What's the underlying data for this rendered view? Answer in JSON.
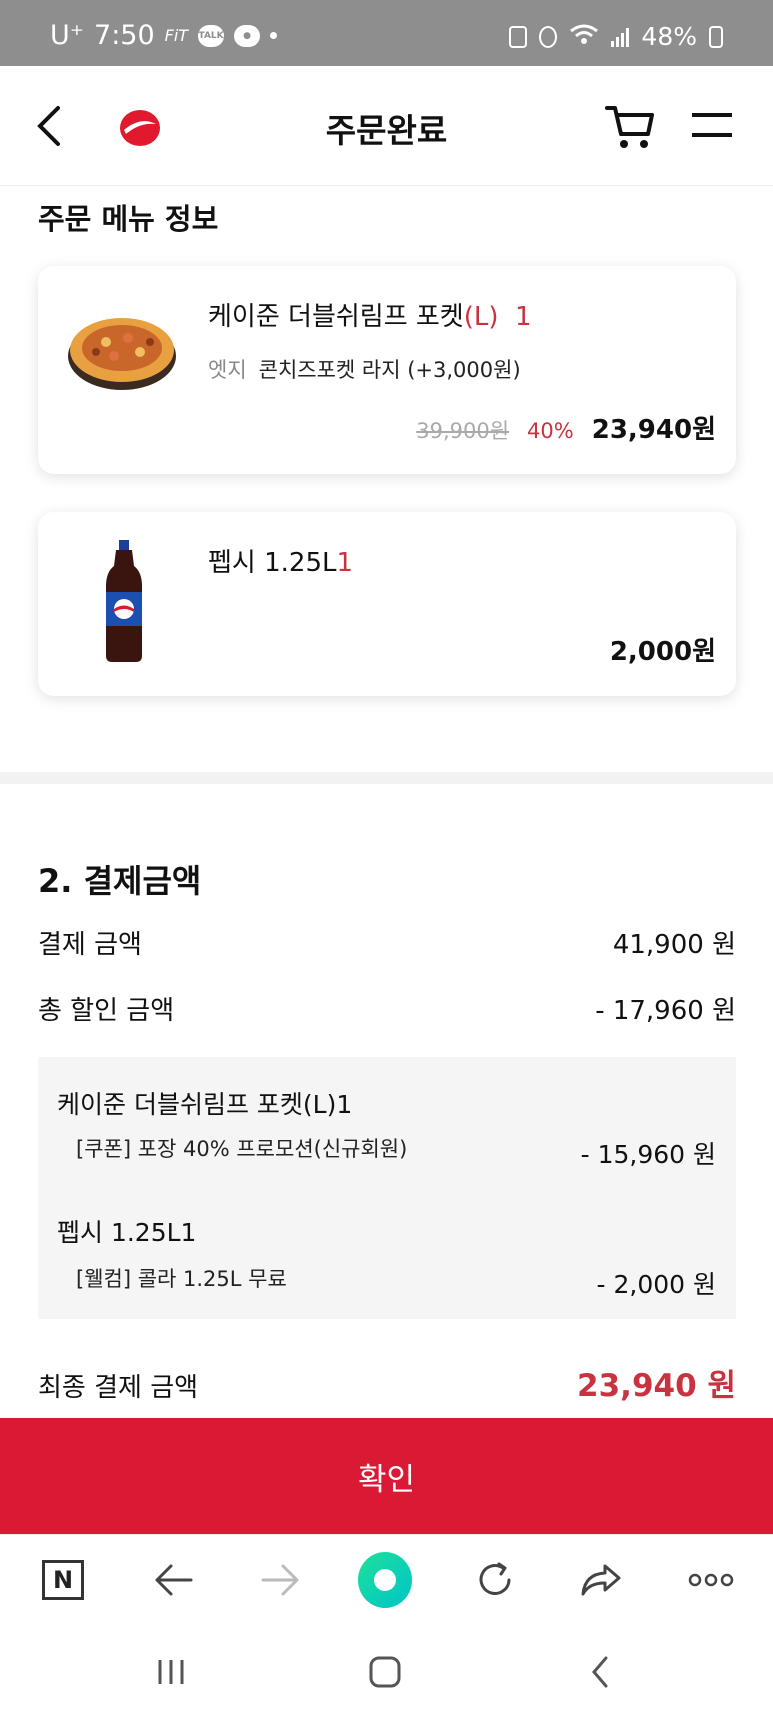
{
  "status_bar": {
    "carrier": "U⁺",
    "time": "7:50",
    "fit_label": "FiT",
    "talk_label": "TALK",
    "battery": "48%"
  },
  "header": {
    "title": "주문완료"
  },
  "order_section": {
    "title": "주문 메뉴 정보",
    "items": [
      {
        "name": "케이준 더블쉬림프 포켓",
        "size": "(L)",
        "qty": "1",
        "option_label": "엣지",
        "option_value": "콘치즈포켓 라지 (+3,000원)",
        "original_price": "39,900원",
        "discount": "40%",
        "price": "23,940원"
      },
      {
        "name": "펩시 1.25L",
        "qty": "1",
        "price": "2,000원"
      }
    ]
  },
  "payment": {
    "title": "2. 결제금액",
    "amount_label": "결제 금액",
    "amount_value": "41,900 원",
    "discount_label": "총 할인 금액",
    "discount_value": "- 17,960 원",
    "details": [
      {
        "name": "케이준 더블쉬림프 포켓(L)1",
        "coupon": "[쿠폰] 포장 40% 프로모션(신규회원)",
        "amount": "- 15,960 원"
      },
      {
        "name": "펩시 1.25L1",
        "coupon": "[웰컴] 콜라 1.25L 무료",
        "amount": "- 2,000 원"
      }
    ],
    "final_label": "최종 결제 금액",
    "final_value": "23,940 원"
  },
  "confirm_button": "확인",
  "browser_bar": {
    "n_label": "N"
  },
  "colors": {
    "accent": "#da1a34",
    "price_red": "#c8333f"
  }
}
